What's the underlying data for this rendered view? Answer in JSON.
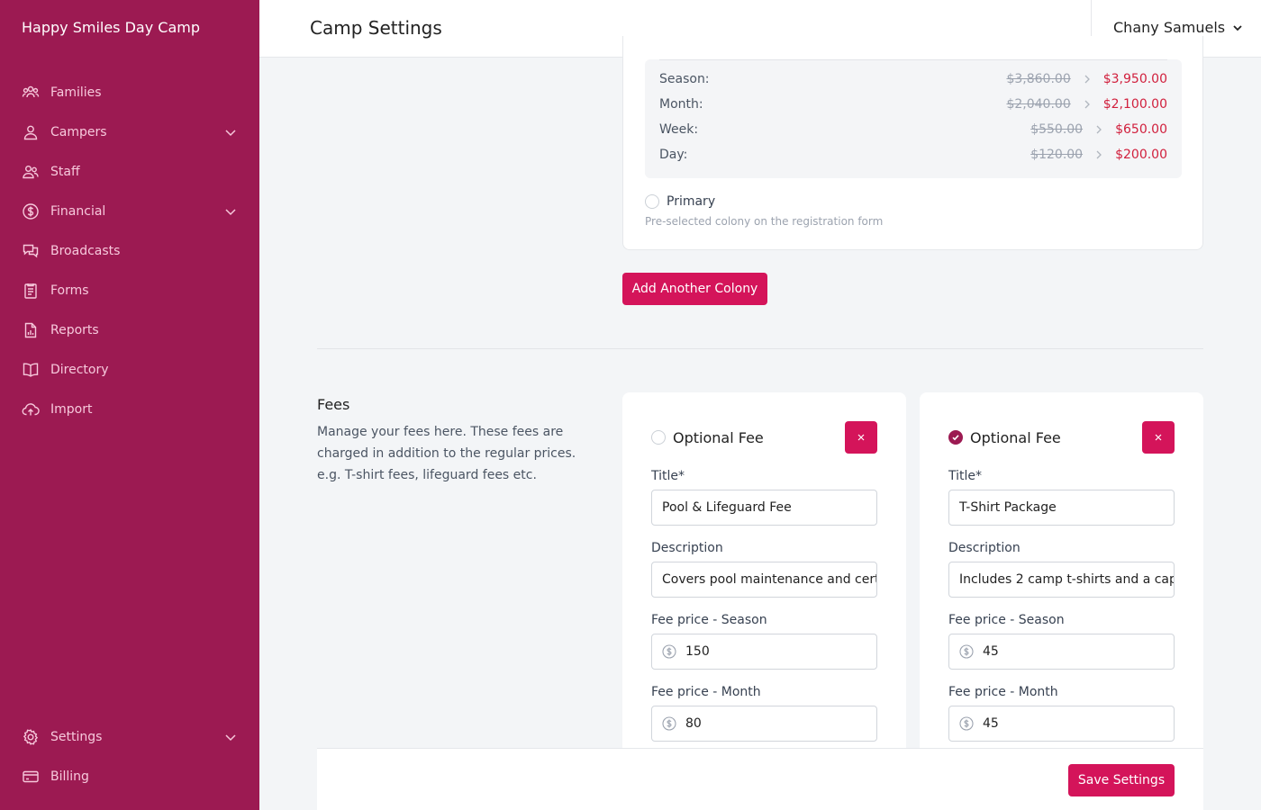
{
  "app": {
    "name": "Happy Smiles Day Camp"
  },
  "colors": {
    "sidebar": "#9c1a52",
    "accent": "#d4145a",
    "price_new": "#d1203d"
  },
  "sidebar": {
    "items": [
      {
        "label": "Families",
        "icon": "families-icon"
      },
      {
        "label": "Campers",
        "icon": "user-icon",
        "expandable": true
      },
      {
        "label": "Staff",
        "icon": "staff-icon"
      },
      {
        "label": "Financial",
        "icon": "dollar-icon",
        "expandable": true
      },
      {
        "label": "Broadcasts",
        "icon": "chat-icon"
      },
      {
        "label": "Forms",
        "icon": "forms-icon"
      },
      {
        "label": "Reports",
        "icon": "reports-icon"
      },
      {
        "label": "Directory",
        "icon": "book-icon"
      },
      {
        "label": "Import",
        "icon": "cloud-upload-icon"
      }
    ],
    "bottom_items": [
      {
        "label": "Settings",
        "icon": "gear-icon",
        "expandable": true
      },
      {
        "label": "Billing",
        "icon": "credit-card-icon"
      }
    ]
  },
  "header": {
    "title": "Camp Settings",
    "user_name": "Chany Samuels"
  },
  "colony": {
    "prices": [
      {
        "label": "Season:",
        "old": "$3,860.00",
        "new": "$3,950.00"
      },
      {
        "label": "Month:",
        "old": "$2,040.00",
        "new": "$2,100.00"
      },
      {
        "label": "Week:",
        "old": "$550.00",
        "new": "$650.00"
      },
      {
        "label": "Day:",
        "old": "$120.00",
        "new": "$200.00"
      }
    ],
    "primary_label": "Primary",
    "primary_checked": false,
    "primary_help": "Pre-selected colony on the registration form",
    "add_button": "Add Another Colony"
  },
  "fees": {
    "title": "Fees",
    "description": "Manage your fees here. These fees are charged in addition to the regular prices. e.g. T-shirt fees, lifeguard fees etc.",
    "labels": {
      "title": "Title*",
      "description": "Description",
      "season": "Fee price - Season",
      "month": "Fee price - Month"
    },
    "items": [
      {
        "optional_label": "Optional Fee",
        "optional_checked": false,
        "title": "Pool & Lifeguard Fee",
        "description": "Covers pool maintenance and certified lifeguards",
        "season_price": "150",
        "month_price": "80"
      },
      {
        "optional_label": "Optional Fee",
        "optional_checked": true,
        "title": "T-Shirt Package",
        "description": "Includes 2 camp t-shirts and a cap",
        "season_price": "45",
        "month_price": "45"
      }
    ]
  },
  "footer": {
    "save_button": "Save Settings"
  }
}
